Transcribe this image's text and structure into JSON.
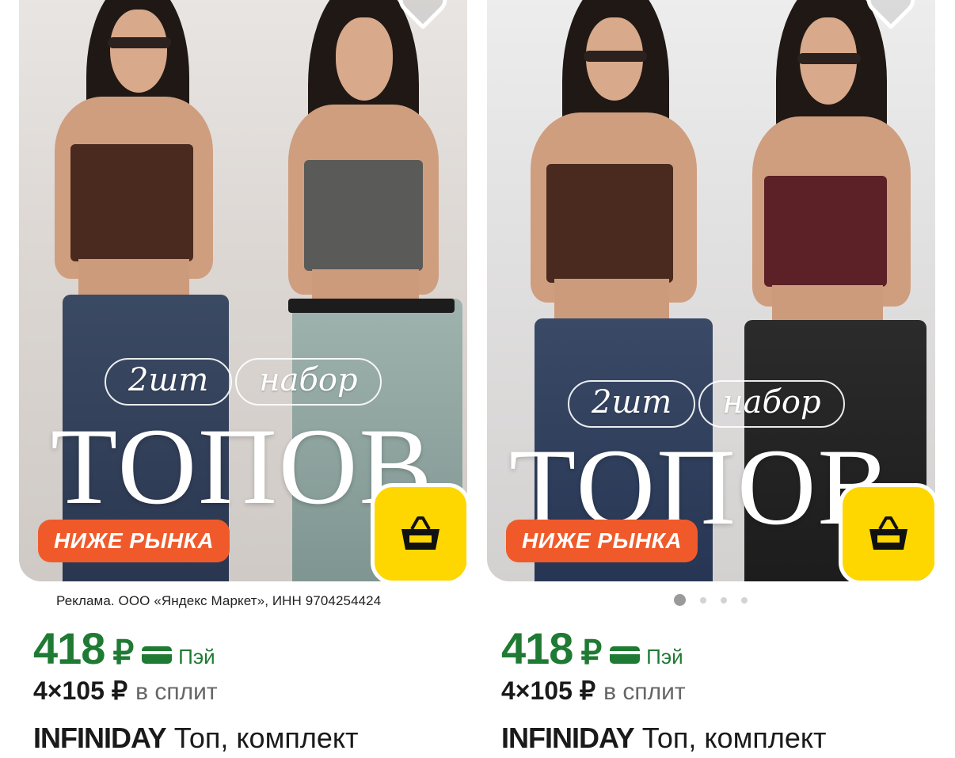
{
  "colors": {
    "price_green": "#1f7a33",
    "promo_orange": "#f05a2b",
    "cart_yellow": "#ffd700"
  },
  "cards": [
    {
      "image_overlay": {
        "pill_1": "2шт",
        "pill_2": "набор",
        "big_word": "ТОПОВ"
      },
      "promo_badge": "НИЖЕ РЫНКА",
      "icons": {
        "favorite": "heart-icon",
        "cart": "basket-icon"
      },
      "ad_disclaimer": "Реклама. ООО «Яндекс Маркет», ИНН 9704254424",
      "price": "418",
      "currency": "₽",
      "pay_label": "Пэй",
      "split_amount": "4×105 ₽",
      "split_label": "в сплит",
      "brand": "INFINIDAY",
      "title": "Топ, комплект"
    },
    {
      "image_overlay": {
        "pill_1": "2шт",
        "pill_2": "набор",
        "big_word": "ТОПОВ"
      },
      "promo_badge": "НИЖЕ РЫНКА",
      "icons": {
        "favorite": "heart-icon",
        "cart": "basket-icon"
      },
      "carousel": {
        "total": 4,
        "active": 1
      },
      "price": "418",
      "currency": "₽",
      "pay_label": "Пэй",
      "split_amount": "4×105 ₽",
      "split_label": "в сплит",
      "brand": "INFINIDAY",
      "title": "Топ, комплект"
    }
  ]
}
